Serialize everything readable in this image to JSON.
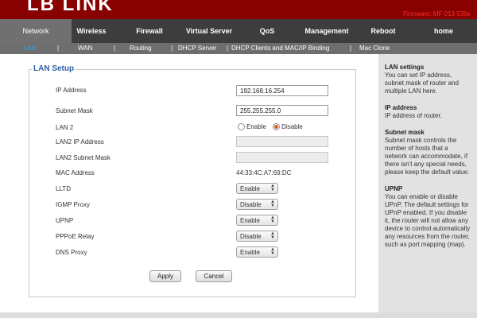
{
  "header": {
    "logo_text": "LB LINK",
    "firmware": "Firmware: MF 013 536e"
  },
  "nav": {
    "items": [
      {
        "label": "Network",
        "active": true
      },
      {
        "label": "Wireless"
      },
      {
        "label": "Firewall"
      },
      {
        "label": "Virtual Server"
      },
      {
        "label": "QoS"
      },
      {
        "label": "Management"
      },
      {
        "label": "Reboot"
      },
      {
        "label": "home"
      }
    ]
  },
  "subnav": {
    "items": [
      {
        "label": "LAN",
        "active": true
      },
      {
        "label": "WAN"
      },
      {
        "label": "Routing"
      },
      {
        "label": "DHCP Server"
      },
      {
        "label": "DHCP Clients and MAC/IP Binding"
      },
      {
        "label": "Mac Clone"
      }
    ],
    "separator": "|"
  },
  "lan_setup": {
    "title": "LAN Setup",
    "ip_address": {
      "label": "IP Address",
      "value": "192.168.16.254"
    },
    "subnet_mask": {
      "label": "Subnet Mask",
      "value": "255.255.255.0"
    },
    "lan2": {
      "label": "LAN 2",
      "options": [
        "Enable",
        "Disable"
      ],
      "selected": "Disable"
    },
    "lan2_ip": {
      "label": "LAN2 IP Address",
      "value": ""
    },
    "lan2_subnet": {
      "label": "LAN2 Subnet Mask",
      "value": ""
    },
    "mac_address": {
      "label": "MAC Address",
      "value": "44:33:4C:A7:69:DC"
    },
    "lltd": {
      "label": "LLTD",
      "value": "Enable"
    },
    "igmp_proxy": {
      "label": "IGMP Proxy",
      "value": "Disable"
    },
    "upnp": {
      "label": "UPNP",
      "value": "Enable"
    },
    "pppoe_relay": {
      "label": "PPPoE Relay",
      "value": "Disable"
    },
    "dns_proxy": {
      "label": "DNS Proxy",
      "value": "Enable"
    },
    "apply_label": "Apply",
    "cancel_label": "Cancel"
  },
  "help": {
    "sections": [
      {
        "title": "LAN settings",
        "text": "You can set IP address, subnet mask of router and multiple LAN here."
      },
      {
        "title": "IP address",
        "text": "IP address of router."
      },
      {
        "title": "Subnet mask",
        "text": "Subnet mask controls the number of hosts that a network can accommodate, if there isn't any special needs, please keep the default value."
      },
      {
        "title": "UPNP",
        "text": "You can enable or disable UPnP. The default settings for UPnP enabled. If you disable it, the router will not allow any device to control automatically any resources from the router, such as port mapping (map)."
      }
    ]
  },
  "colors": {
    "header_bg": "#880000",
    "nav_bg": "#3d3d3d",
    "nav_active_bg": "#707070",
    "subnav_bg": "#6e6e6e",
    "subnav_active": "#2ea8e8",
    "legend_color": "#2f5da8",
    "radio_checked": "#e8572a",
    "help_bg": "#e2e2e2"
  }
}
